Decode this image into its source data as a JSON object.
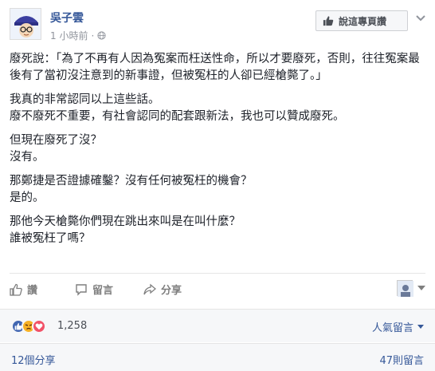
{
  "post": {
    "author": "吳子雲",
    "time": "1 小時前",
    "meta_separator": "·",
    "translate_label": "說這專頁讚",
    "paragraphs": [
      "廢死說：「為了不再有人因為冤案而枉送性命，所以才要廢死，否則，往往冤案最後有了當初沒注意到的新事證，但被冤枉的人卻已經槍斃了。」",
      "我真的非常認同以上這些話。\n廢不廢死不重要，有社會認同的配套跟新法，我也可以贊成廢死。",
      "但現在廢死了沒？\n沒有。",
      "那鄭捷是否證據確鑿？沒有任何被冤枉的機會？\n是的。",
      "那他今天槍斃你們現在跳出來叫是在叫什麼？\n誰被冤枉了嗎？"
    ]
  },
  "actions": {
    "like": "讚",
    "comment": "留言",
    "share": "分享"
  },
  "reactions": {
    "count": "1,258",
    "sort_label": "人氣留言",
    "icons": [
      "thumbs-up-icon",
      "angry-icon",
      "heart-icon"
    ]
  },
  "footer": {
    "shares": "12個分享",
    "comments": "47則留言"
  },
  "colors": {
    "link": "#365899",
    "muted": "#90949c",
    "like": "#4267b2",
    "angry": "#f7b125",
    "love": "#f25268"
  }
}
